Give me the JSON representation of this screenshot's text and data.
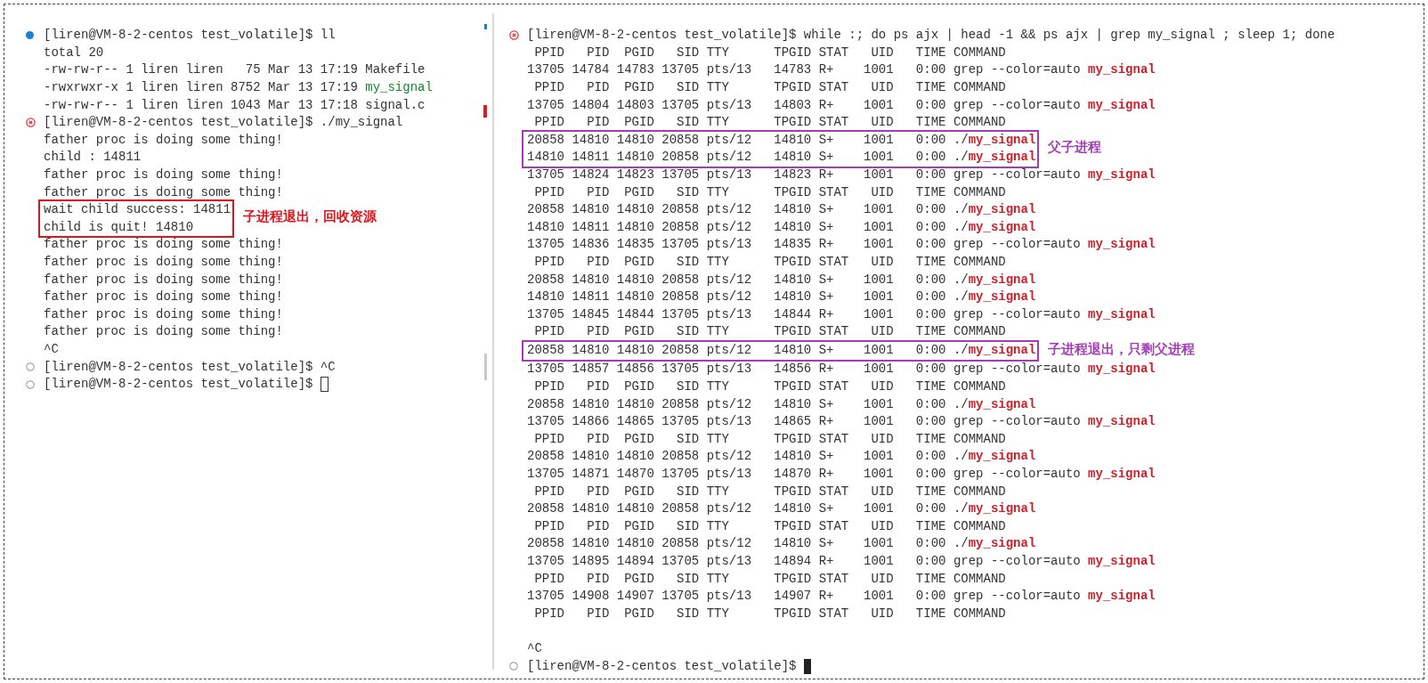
{
  "panes": [
    {
      "items": [
        {
          "kind": "line",
          "marker": {
            "kind": "info"
          },
          "text": "[liren@VM-8-2-centos test_volatile]$ ll"
        },
        {
          "kind": "line",
          "text": "total 20"
        },
        {
          "kind": "line",
          "text": "-rw-rw-r-- 1 liren liren   75 Mar 13 17:19 Makefile"
        },
        {
          "kind": "line",
          "text": "-rwxrwxr-x 1 liren liren 8752 Mar 13 17:19 ",
          "tail": {
            "text": "my_signal",
            "kind": "exec"
          }
        },
        {
          "kind": "line",
          "text": "-rw-rw-r-- 1 liren liren 1043 Mar 13 17:18 signal.c"
        },
        {
          "kind": "line",
          "marker": {
            "kind": "error"
          },
          "text": "[liren@VM-8-2-centos test_volatile]$ ./my_signal"
        },
        {
          "kind": "line",
          "text": "father proc is doing some thing!"
        },
        {
          "kind": "line",
          "text": "child : 14811"
        },
        {
          "kind": "line",
          "text": "father proc is doing some thing!"
        },
        {
          "kind": "line",
          "text": "father proc is doing some thing!"
        },
        {
          "kind": "callout",
          "note": "子进程退出，回收资源",
          "color": "#e3131c",
          "lines": [
            {
              "kind": "line",
              "text": "wait child success: 14811"
            },
            {
              "kind": "line",
              "text": "child is quit! 14810"
            }
          ]
        },
        {
          "kind": "line",
          "text": "father proc is doing some thing!"
        },
        {
          "kind": "line",
          "text": "father proc is doing some thing!"
        },
        {
          "kind": "line",
          "text": "father proc is doing some thing!"
        },
        {
          "kind": "line",
          "text": "father proc is doing some thing!"
        },
        {
          "kind": "line",
          "text": "father proc is doing some thing!"
        },
        {
          "kind": "line",
          "text": "father proc is doing some thing!"
        },
        {
          "kind": "line",
          "text": "^C"
        },
        {
          "kind": "line",
          "marker": {
            "kind": "idle"
          },
          "text": "[liren@VM-8-2-centos test_volatile]$ ^C"
        },
        {
          "kind": "line",
          "marker": {
            "kind": "idle"
          },
          "text": "[liren@VM-8-2-centos test_volatile]$ ",
          "cursor": {
            "kind": "hollow"
          }
        }
      ]
    },
    {
      "items": [
        {
          "kind": "line",
          "marker": {
            "kind": "error"
          },
          "text": "[liren@VM-8-2-centos test_volatile]$ while :; do ps ajx | head -1 && ps ajx | grep my_signal ; sleep 1; done"
        },
        {
          "kind": "line",
          "text": " PPID   PID  PGID   SID TTY      TPGID STAT   UID   TIME COMMAND"
        },
        {
          "kind": "line",
          "text": "13705 14784 14783 13705 pts/13   14783 R+    1001   0:00 grep --color=auto ",
          "tail": {
            "text": "my_signal",
            "kind": "grep"
          }
        },
        {
          "kind": "line",
          "text": " PPID   PID  PGID   SID TTY      TPGID STAT   UID   TIME COMMAND"
        },
        {
          "kind": "line",
          "text": "13705 14804 14803 13705 pts/13   14803 R+    1001   0:00 grep --color=auto ",
          "tail": {
            "text": "my_signal",
            "kind": "grep"
          }
        },
        {
          "kind": "line",
          "text": " PPID   PID  PGID   SID TTY      TPGID STAT   UID   TIME COMMAND"
        },
        {
          "kind": "callout",
          "note": "父子进程",
          "color": "#a53bb5",
          "lines": [
            {
              "kind": "line",
              "text": "20858 14810 14810 20858 pts/12   14810 S+    1001   0:00 ./",
              "tail": {
                "text": "my_signal",
                "kind": "grep"
              }
            },
            {
              "kind": "line",
              "text": "14810 14811 14810 20858 pts/12   14810 S+    1001   0:00 ./",
              "tail": {
                "text": "my_signal",
                "kind": "grep"
              }
            }
          ]
        },
        {
          "kind": "line",
          "text": "13705 14824 14823 13705 pts/13   14823 R+    1001   0:00 grep --color=auto ",
          "tail": {
            "text": "my_signal",
            "kind": "grep"
          }
        },
        {
          "kind": "line",
          "text": " PPID   PID  PGID   SID TTY      TPGID STAT   UID   TIME COMMAND"
        },
        {
          "kind": "line",
          "text": "20858 14810 14810 20858 pts/12   14810 S+    1001   0:00 ./",
          "tail": {
            "text": "my_signal",
            "kind": "grep"
          }
        },
        {
          "kind": "line",
          "text": "14810 14811 14810 20858 pts/12   14810 S+    1001   0:00 ./",
          "tail": {
            "text": "my_signal",
            "kind": "grep"
          }
        },
        {
          "kind": "line",
          "text": "13705 14836 14835 13705 pts/13   14835 R+    1001   0:00 grep --color=auto ",
          "tail": {
            "text": "my_signal",
            "kind": "grep"
          }
        },
        {
          "kind": "line",
          "text": " PPID   PID  PGID   SID TTY      TPGID STAT   UID   TIME COMMAND"
        },
        {
          "kind": "line",
          "text": "20858 14810 14810 20858 pts/12   14810 S+    1001   0:00 ./",
          "tail": {
            "text": "my_signal",
            "kind": "grep"
          }
        },
        {
          "kind": "line",
          "text": "14810 14811 14810 20858 pts/12   14810 S+    1001   0:00 ./",
          "tail": {
            "text": "my_signal",
            "kind": "grep"
          }
        },
        {
          "kind": "line",
          "text": "13705 14845 14844 13705 pts/13   14844 R+    1001   0:00 grep --color=auto ",
          "tail": {
            "text": "my_signal",
            "kind": "grep"
          }
        },
        {
          "kind": "line",
          "text": " PPID   PID  PGID   SID TTY      TPGID STAT   UID   TIME COMMAND"
        },
        {
          "kind": "callout",
          "note": "子进程退出，只剩父进程",
          "color": "#a53bb5",
          "lines": [
            {
              "kind": "line",
              "text": "20858 14810 14810 20858 pts/12   14810 S+    1001   0:00 ./",
              "tail": {
                "text": "my_signal",
                "kind": "grep"
              }
            }
          ]
        },
        {
          "kind": "line",
          "text": "13705 14857 14856 13705 pts/13   14856 R+    1001   0:00 grep --color=auto ",
          "tail": {
            "text": "my_signal",
            "kind": "grep"
          }
        },
        {
          "kind": "line",
          "text": " PPID   PID  PGID   SID TTY      TPGID STAT   UID   TIME COMMAND"
        },
        {
          "kind": "line",
          "text": "20858 14810 14810 20858 pts/12   14810 S+    1001   0:00 ./",
          "tail": {
            "text": "my_signal",
            "kind": "grep"
          }
        },
        {
          "kind": "line",
          "text": "13705 14866 14865 13705 pts/13   14865 R+    1001   0:00 grep --color=auto ",
          "tail": {
            "text": "my_signal",
            "kind": "grep"
          }
        },
        {
          "kind": "line",
          "text": " PPID   PID  PGID   SID TTY      TPGID STAT   UID   TIME COMMAND"
        },
        {
          "kind": "line",
          "text": "20858 14810 14810 20858 pts/12   14810 S+    1001   0:00 ./",
          "tail": {
            "text": "my_signal",
            "kind": "grep"
          }
        },
        {
          "kind": "line",
          "text": "13705 14871 14870 13705 pts/13   14870 R+    1001   0:00 grep --color=auto ",
          "tail": {
            "text": "my_signal",
            "kind": "grep"
          }
        },
        {
          "kind": "line",
          "text": " PPID   PID  PGID   SID TTY      TPGID STAT   UID   TIME COMMAND"
        },
        {
          "kind": "line",
          "text": "20858 14810 14810 20858 pts/12   14810 S+    1001   0:00 ./",
          "tail": {
            "text": "my_signal",
            "kind": "grep"
          }
        },
        {
          "kind": "line",
          "text": " PPID   PID  PGID   SID TTY      TPGID STAT   UID   TIME COMMAND"
        },
        {
          "kind": "line",
          "text": "20858 14810 14810 20858 pts/12   14810 S+    1001   0:00 ./",
          "tail": {
            "text": "my_signal",
            "kind": "grep"
          }
        },
        {
          "kind": "line",
          "text": "13705 14895 14894 13705 pts/13   14894 R+    1001   0:00 grep --color=auto ",
          "tail": {
            "text": "my_signal",
            "kind": "grep"
          }
        },
        {
          "kind": "line",
          "text": " PPID   PID  PGID   SID TTY      TPGID STAT   UID   TIME COMMAND"
        },
        {
          "kind": "line",
          "text": "13705 14908 14907 13705 pts/13   14907 R+    1001   0:00 grep --color=auto ",
          "tail": {
            "text": "my_signal",
            "kind": "grep"
          }
        },
        {
          "kind": "line",
          "text": " PPID   PID  PGID   SID TTY      TPGID STAT   UID   TIME COMMAND"
        },
        {
          "kind": "gap"
        },
        {
          "kind": "line",
          "text": "^C"
        },
        {
          "kind": "line",
          "marker": {
            "kind": "idle"
          },
          "text": "[liren@VM-8-2-centos test_volatile]$ ",
          "cursor": {
            "kind": "block"
          }
        }
      ]
    }
  ]
}
